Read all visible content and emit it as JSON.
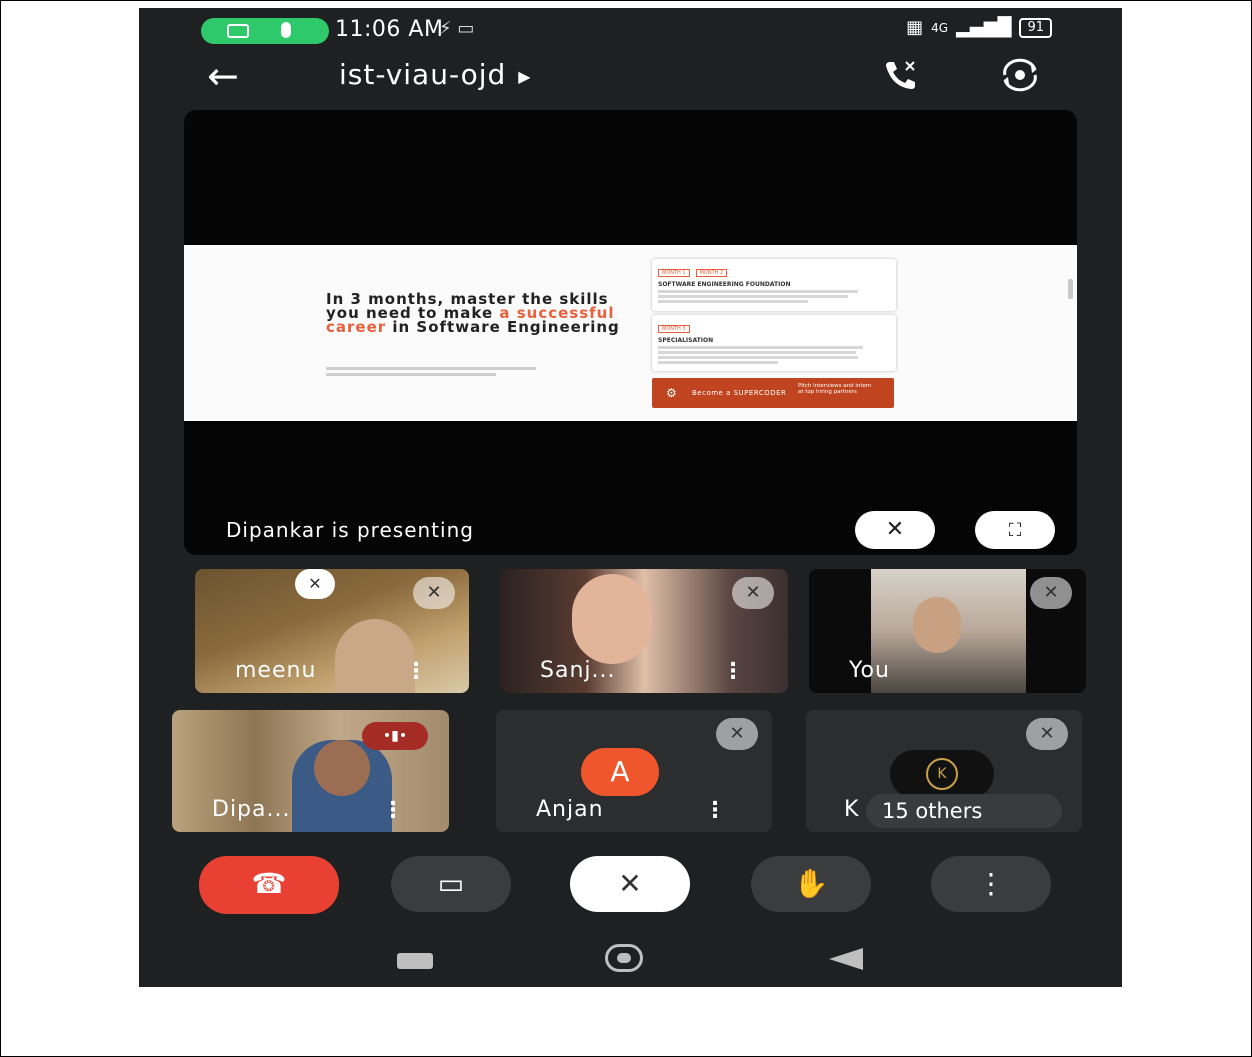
{
  "status_bar": {
    "time": "11:06 AM",
    "network": "4G",
    "battery": "91"
  },
  "header": {
    "meeting_code": "ist-viau-ojd",
    "back_icon": "arrow-left-icon",
    "audio_icon": "phone-audio-icon",
    "switch_camera_icon": "switch-camera-icon"
  },
  "presentation": {
    "presenting_label": "Dipankar is presenting",
    "slide": {
      "headline_part1": "In 3 months, master the skills you need to make ",
      "headline_highlight": "a successful career",
      "headline_part2": " in Software Engineering",
      "card1_tags": [
        "MONTH 1",
        "MONTH 2"
      ],
      "card1_title": "SOFTWARE ENGINEERING FOUNDATION",
      "card2_tag": "MONTH 3",
      "card2_title": "SPECIALISATION",
      "cta_left": "Become a SUPERCODER",
      "cta_right": "Pitch interviews and intern at top hiring partners"
    }
  },
  "participants": [
    {
      "name": "meenu"
    },
    {
      "name": "Sanj..."
    },
    {
      "name": "You"
    },
    {
      "name": "Dipa..."
    },
    {
      "name": "Anjan",
      "initial": "A"
    },
    {
      "name": "K",
      "others_label": "15 others",
      "avatar_letter": "K"
    }
  ],
  "colors": {
    "accent_orange": "#f0562c",
    "end_call_red": "#e84134",
    "green_pill": "#2ec96a",
    "speaking_red": "#a52b25"
  }
}
